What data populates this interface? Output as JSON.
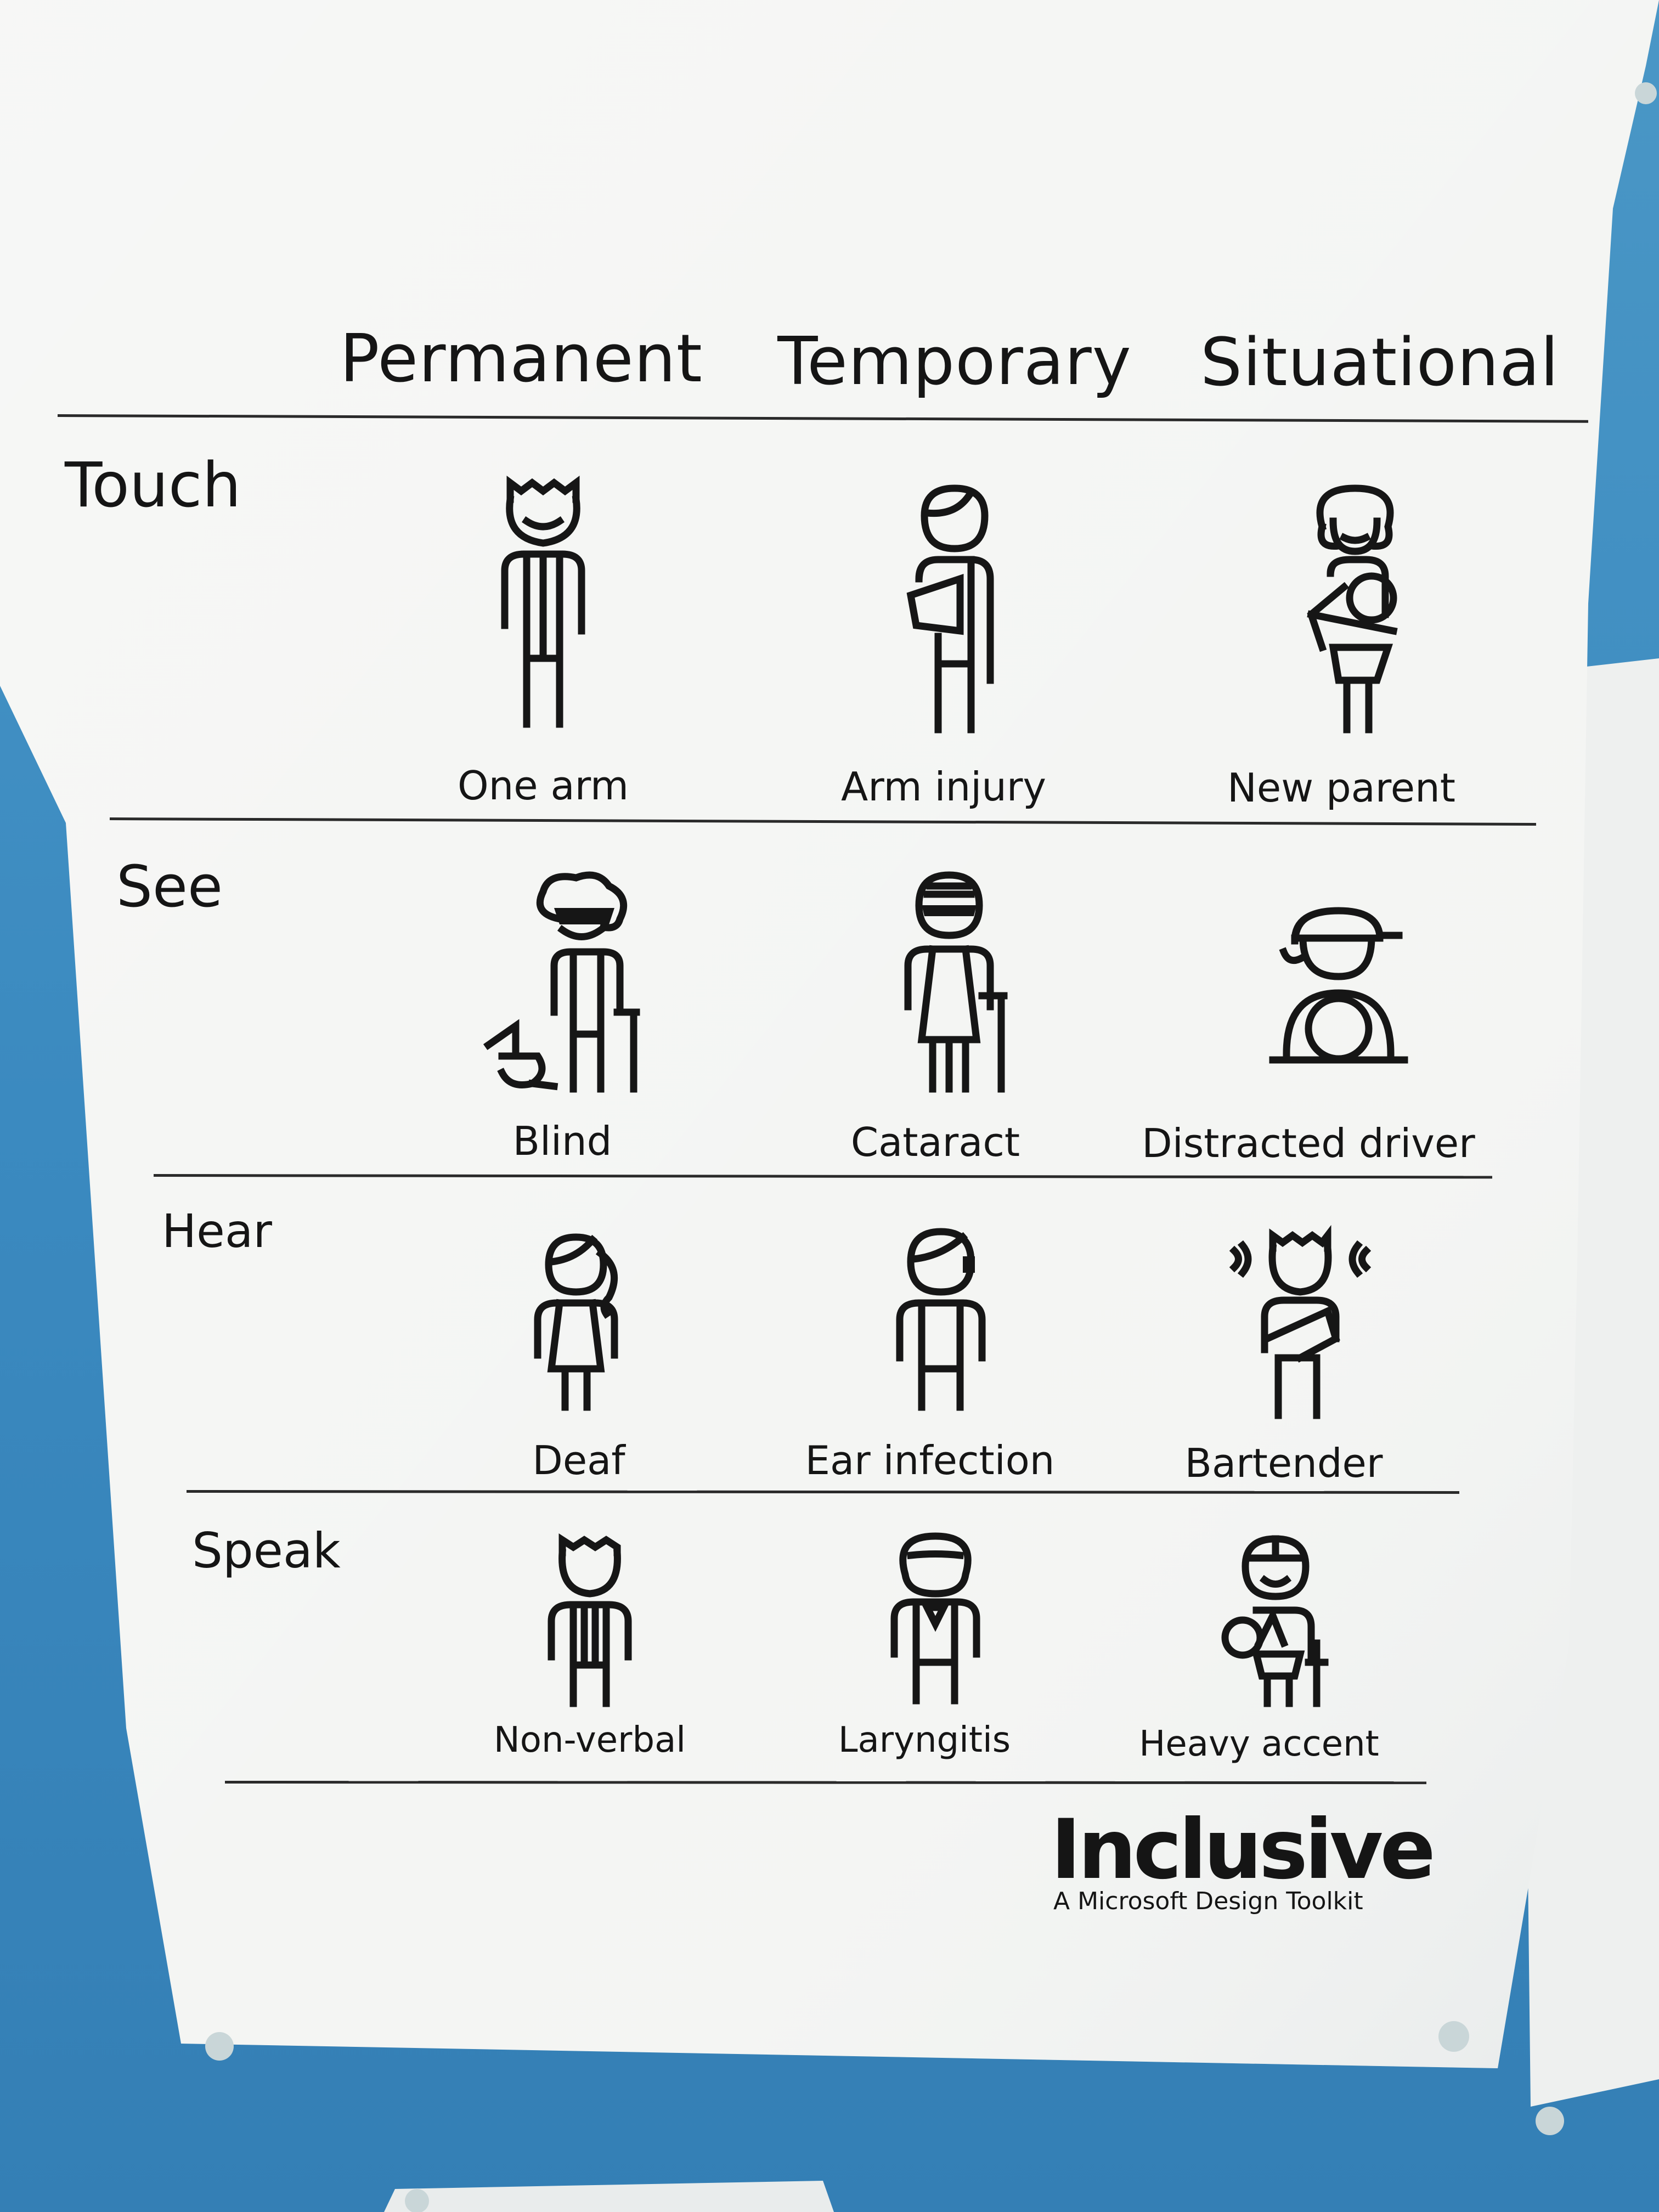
{
  "columns": [
    "Permanent",
    "Temporary",
    "Situational"
  ],
  "rows": [
    {
      "label": "Touch",
      "items": [
        {
          "caption": "One arm",
          "icon": "one-arm-person-icon"
        },
        {
          "caption": "Arm injury",
          "icon": "arm-injury-person-icon"
        },
        {
          "caption": "New parent",
          "icon": "new-parent-person-icon"
        }
      ]
    },
    {
      "label": "See",
      "items": [
        {
          "caption": "Blind",
          "icon": "blind-person-with-guide-dog-icon"
        },
        {
          "caption": "Cataract",
          "icon": "cataract-person-with-cane-icon"
        },
        {
          "caption": "Distracted driver",
          "icon": "distracted-driver-icon"
        }
      ]
    },
    {
      "label": "Hear",
      "items": [
        {
          "caption": "Deaf",
          "icon": "deaf-person-icon"
        },
        {
          "caption": "Ear infection",
          "icon": "ear-infection-person-icon"
        },
        {
          "caption": "Bartender",
          "icon": "bartender-person-icon"
        }
      ]
    },
    {
      "label": "Speak",
      "items": [
        {
          "caption": "Non-verbal",
          "icon": "non-verbal-person-icon"
        },
        {
          "caption": "Laryngitis",
          "icon": "laryngitis-person-icon"
        },
        {
          "caption": "Heavy accent",
          "icon": "heavy-accent-person-icon"
        }
      ]
    }
  ],
  "brand": {
    "name": "Inclusive",
    "tagline": "A Microsoft Design Toolkit"
  },
  "colors": {
    "board": "#3e8fbf",
    "paper": "#f4f5f3",
    "ink": "#151515"
  }
}
